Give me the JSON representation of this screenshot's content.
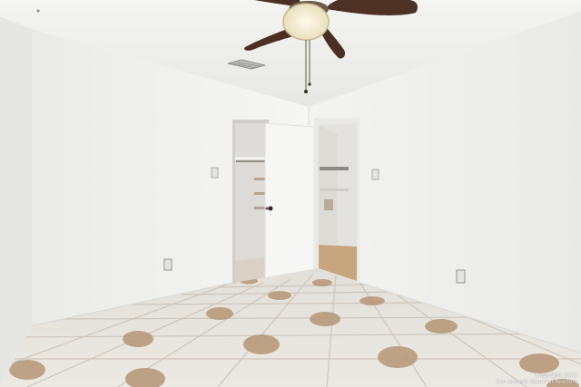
{
  "photo": {
    "subject": "empty-bedroom",
    "colors": {
      "ceiling": "#eeeeea",
      "wall_left": "#f1f1ee",
      "wall_back": "#ececea",
      "wall_right": "#f0f0ed",
      "floor_base": "#e9e6e0",
      "tile_accent": "#b6977a",
      "grout": "#c9c3b9",
      "fan_blade": "#4a2f22",
      "fan_light": "#f7f0d8",
      "door": "#f5f5f3",
      "closet_interior": "#d9d8d4",
      "walkin_floor": "#c2a27e"
    }
  },
  "watermark": {
    "line1": "Copyright 2025",
    "line2": "San Antonio Board of Realtors"
  }
}
